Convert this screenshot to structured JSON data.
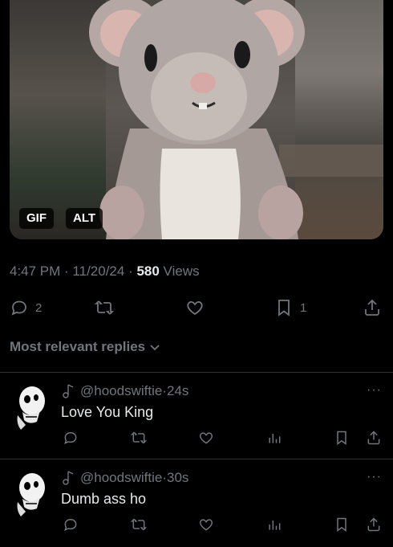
{
  "media": {
    "gif_badge": "GIF",
    "alt_badge": "ALT",
    "icon": "felted-mouse-image"
  },
  "meta": {
    "time": "4:47 PM",
    "sep1": " · ",
    "date": "11/20/24",
    "sep2": " · ",
    "views_count": "580",
    "views_label": " Views"
  },
  "actions": {
    "replies_count": "2",
    "bookmarks_count": "1"
  },
  "sort": {
    "label": "Most relevant replies"
  },
  "replies": [
    {
      "handle": "@hoodswiftie",
      "time": "24s",
      "text": "Love You King",
      "more": "···"
    },
    {
      "handle": "@hoodswiftie",
      "time": "30s",
      "text": "Dumb ass ho",
      "more": "···"
    }
  ],
  "colors": {
    "background": "#000000",
    "text": "#e7e9ea",
    "muted": "#71767b",
    "divider": "#2f3336"
  }
}
